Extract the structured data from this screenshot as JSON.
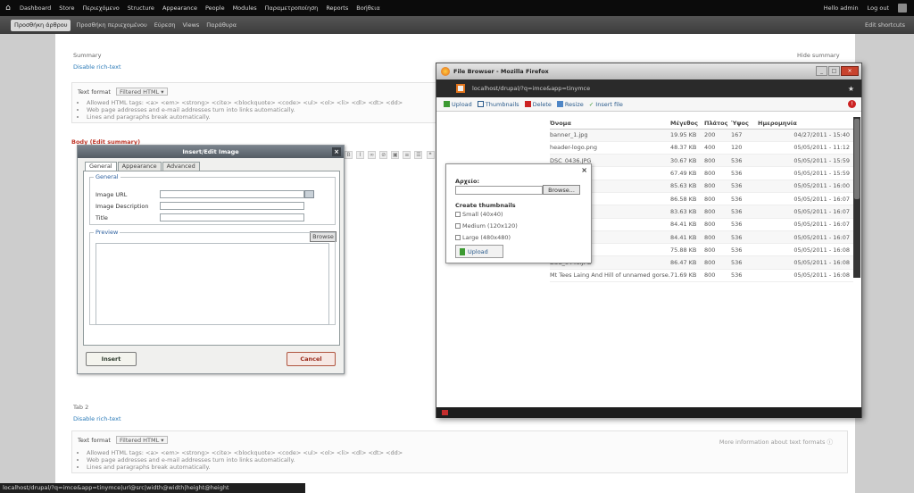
{
  "toolbar": {
    "items": [
      "Dashboard",
      "Store",
      "Περιεχόμενο",
      "Structure",
      "Appearance",
      "People",
      "Modules",
      "Παραμετροποίηση",
      "Reports",
      "Βοήθεια"
    ],
    "greeting": "Hello admin",
    "logout": "Log out"
  },
  "shortcuts": {
    "active": "Προσθήκη άρθρου",
    "items": [
      "Προσθήκη περιεχομένου",
      "Εύρεση",
      "Views",
      "Παράθυρα"
    ],
    "edit": "Edit shortcuts"
  },
  "form": {
    "summary_label": "Summary",
    "summary_toggle": "Hide summary",
    "disable_rich": "Disable rich-text",
    "format_label": "Text format",
    "format_value": "Filtered HTML",
    "tips": [
      "Allowed HTML tags: <a> <em> <strong> <cite> <blockquote> <code> <ul> <ol> <li> <dl> <dt> <dd>",
      "Web page addresses and e-mail addresses turn into links automatically.",
      "Lines and paragraphs break automatically."
    ],
    "body_label": "Body (Edit summary)",
    "field2_label": "Tab 2",
    "more_info": "More information about text formats ⓘ"
  },
  "image_dialog": {
    "title": "Insert/Edit Image",
    "tabs": [
      "General",
      "Appearance",
      "Advanced"
    ],
    "general_legend": "General",
    "image_url_label": "Image URL",
    "description_label": "Image Description",
    "title_label": "Title",
    "browse_tip": "Browse",
    "preview_legend": "Preview",
    "insert": "Insert",
    "cancel": "Cancel"
  },
  "file_browser": {
    "window_title": "File Browser - Mozilla Firefox",
    "url": "localhost/drupal/?q=imce&app=tinymce",
    "toolbar": [
      "Upload",
      "Thumbnails",
      "Delete",
      "Resize",
      "Insert file"
    ],
    "columns": [
      "Όνομα",
      "Μέγεθος",
      "Πλάτος",
      "Ύψος",
      "Ημερομηνία"
    ],
    "files": [
      {
        "name": "banner_1.jpg",
        "size": "19.95 KB",
        "width": "200",
        "height": "167",
        "date": "04/27/2011 - 15:40"
      },
      {
        "name": "header-logo.png",
        "size": "48.37 KB",
        "width": "400",
        "height": "120",
        "date": "05/05/2011 - 11:12"
      },
      {
        "name": "DSC_0436.JPG",
        "size": "30.67 KB",
        "width": "800",
        "height": "536",
        "date": "05/05/2011 - 15:59"
      },
      {
        "name": "DSC_0437.JPG",
        "size": "67.49 KB",
        "width": "800",
        "height": "536",
        "date": "05/05/2011 - 15:59"
      },
      {
        "name": "DSC_0438.JPG",
        "size": "85.63 KB",
        "width": "800",
        "height": "536",
        "date": "05/05/2011 - 16:00"
      },
      {
        "name": "DSC_0439.JPG",
        "size": "86.58 KB",
        "width": "800",
        "height": "536",
        "date": "05/05/2011 - 16:07"
      },
      {
        "name": "DSC_0440.JPG",
        "size": "83.63 KB",
        "width": "800",
        "height": "536",
        "date": "05/05/2011 - 16:07"
      },
      {
        "name": "DSC_0441.JPG",
        "size": "84.41 KB",
        "width": "800",
        "height": "536",
        "date": "05/05/2011 - 16:07"
      },
      {
        "name": "DSC_0443.JPG",
        "size": "84.41 KB",
        "width": "800",
        "height": "536",
        "date": "05/05/2011 - 16:07"
      },
      {
        "name": "DSC_0444.JPG",
        "size": "75.88 KB",
        "width": "800",
        "height": "536",
        "date": "05/05/2011 - 16:08"
      },
      {
        "name": "DSC_0446.JPG",
        "size": "86.47 KB",
        "width": "800",
        "height": "536",
        "date": "05/05/2011 - 16:08"
      },
      {
        "name": "Mt Tees Laing And Hill of unnamed gorse.jpg",
        "size": "71.69 KB",
        "width": "800",
        "height": "536",
        "date": "05/05/2011 - 16:08"
      }
    ],
    "upload": {
      "file_label": "Αρχείο:",
      "browse": "Browse...",
      "thumbs_title": "Create thumbnails",
      "thumbs": [
        "Small (40x40)",
        "Medium (120x120)",
        "Large (480x480)"
      ],
      "button": "Upload"
    }
  },
  "statusbar": "localhost/drupal/?q=imce&app=tinymce|url@src|width@width|height@height"
}
